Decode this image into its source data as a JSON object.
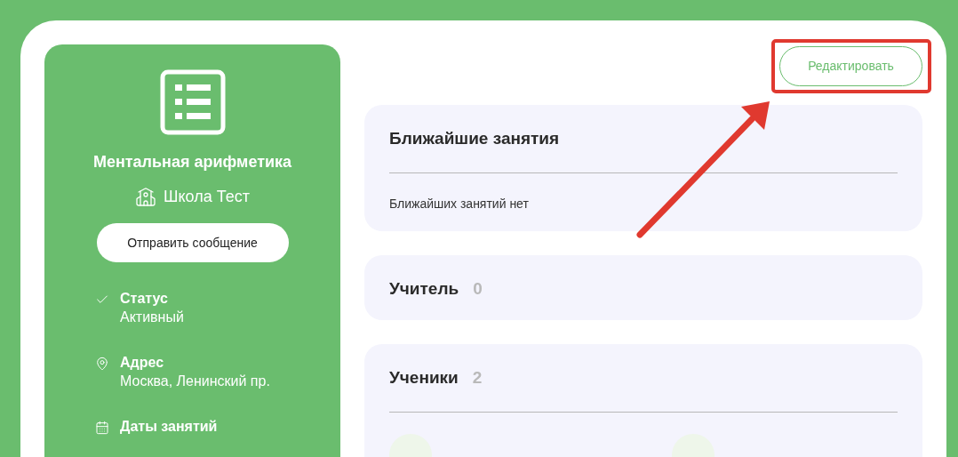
{
  "course": {
    "title": "Ментальная арифметика",
    "school": "Школа Тест",
    "message_button": "Отправить сообщение",
    "info": [
      {
        "kind": "status",
        "label": "Статус",
        "value": "Активный"
      },
      {
        "kind": "address",
        "label": "Адрес",
        "value": "Москва, Ленинский пр."
      },
      {
        "kind": "dates",
        "label": "Даты занятий"
      }
    ]
  },
  "edit_button": "Редактировать",
  "sections": [
    {
      "kind": "lessons",
      "title": "Ближайшие занятия",
      "empty_text": "Ближайших занятий нет"
    },
    {
      "kind": "people",
      "title": "Учитель",
      "count": "0"
    },
    {
      "kind": "people",
      "title": "Ученики",
      "count": "2",
      "expanded": true
    }
  ]
}
